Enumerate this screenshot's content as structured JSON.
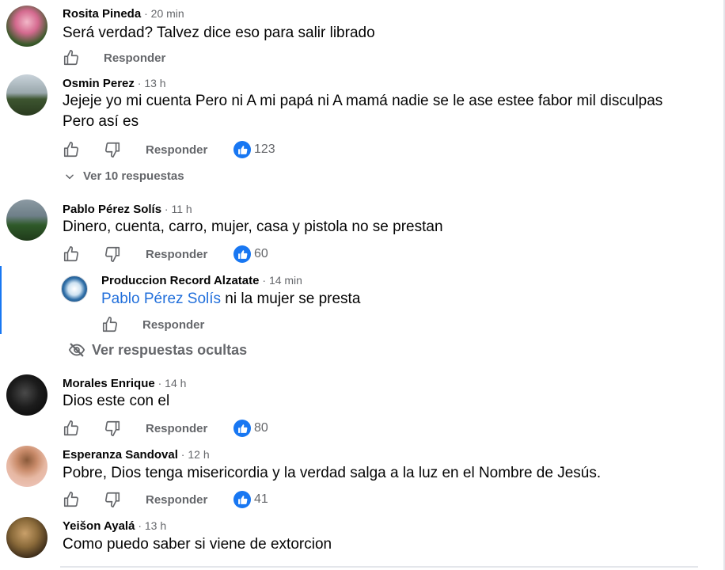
{
  "comments": [
    {
      "author": "Rosita Pineda",
      "time": "20 min",
      "text": "Será verdad? Talvez dice eso para salir librado",
      "reply_label": "Responder"
    },
    {
      "author": "Osmin Perez",
      "time": "13 h",
      "text_line1": "Jejeje yo mi cuenta Pero ni A mi papá ni A mamá nadie se le ase estee fabor mil disculpas",
      "text_line2": "Pero así es",
      "reply_label": "Responder",
      "reaction_count": "123",
      "view_replies": "Ver 10 respuestas"
    },
    {
      "author": "Pablo Pérez Solís",
      "time": "11 h",
      "text": "Dinero, cuenta, carro, mujer, casa y pistola no se prestan",
      "reply_label": "Responder",
      "reaction_count": "60"
    },
    {
      "author": "Morales Enrique",
      "time": "14 h",
      "text": "Dios este con el",
      "reply_label": "Responder",
      "reaction_count": "80"
    },
    {
      "author": "Esperanza Sandoval",
      "time": "12 h",
      "text": "Pobre, Dios tenga misericordia y la verdad salga a la luz en el Nombre de Jesús.",
      "reply_label": "Responder",
      "reaction_count": "41"
    },
    {
      "author": "Yeišon Ayalá",
      "time": "13 h",
      "text": "Como puedo saber si viene de extorcion"
    }
  ],
  "reply": {
    "author": "Produccion Record Alzatate",
    "time": "14 min",
    "mention": "Pablo Pérez Solís",
    "text": " ni la mujer se presta",
    "reply_label": "Responder"
  },
  "hidden_replies_label": "Ver respuestas ocultas",
  "separator": " · ",
  "colors": {
    "accent": "#1877f2",
    "secondary_text": "#65676b",
    "mention": "#216fdb"
  },
  "icons": [
    "thumbs-up-outline-icon",
    "thumbs-down-outline-icon",
    "like-reaction-icon",
    "chevron-down-icon",
    "eye-slash-icon"
  ]
}
